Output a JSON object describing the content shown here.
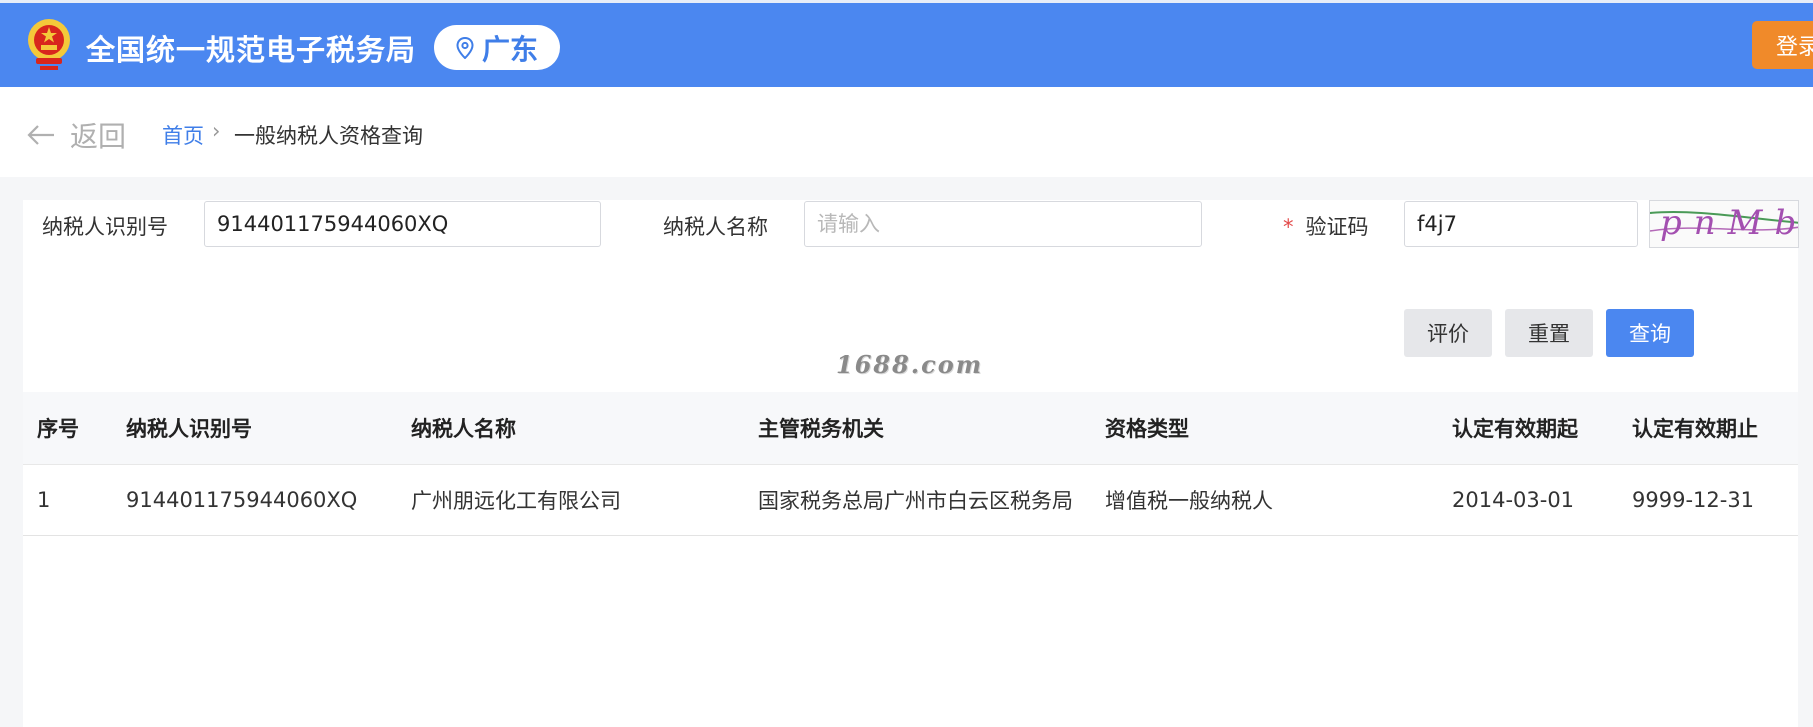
{
  "header": {
    "site_title": "全国统一规范电子税务局",
    "region": "广东",
    "login_label": "登录",
    "accent_color": "#4b87f0",
    "login_color": "#f08a2a",
    "emblem_icon": "national-emblem-icon",
    "pin_icon": "location-pin-icon"
  },
  "breadcrumb": {
    "back_label": "返回",
    "home": "首页",
    "separator": "›",
    "current": "一般纳税人资格查询"
  },
  "form": {
    "taxpayer_id_label": "纳税人识别号",
    "taxpayer_id_value": "914401175944060XQ",
    "taxpayer_name_label": "纳税人名称",
    "taxpayer_name_placeholder": "请输入",
    "captcha_required_mark": "*",
    "captcha_label": "验证码",
    "captcha_value": "f4j7",
    "captcha_image_text": "pnMb",
    "buttons": {
      "evaluate": "评价",
      "reset": "重置",
      "query": "查询"
    }
  },
  "watermark": "1688.com",
  "table": {
    "columns": [
      "序号",
      "纳税人识别号",
      "纳税人名称",
      "主管税务机关",
      "资格类型",
      "认定有效期起",
      "认定有效期止"
    ],
    "rows": [
      [
        "1",
        "914401175944060XQ",
        "广州朋远化工有限公司",
        "国家税务总局广州市白云区税务局",
        "增值税一般纳税人",
        "2014-03-01",
        "9999-12-31"
      ]
    ]
  }
}
